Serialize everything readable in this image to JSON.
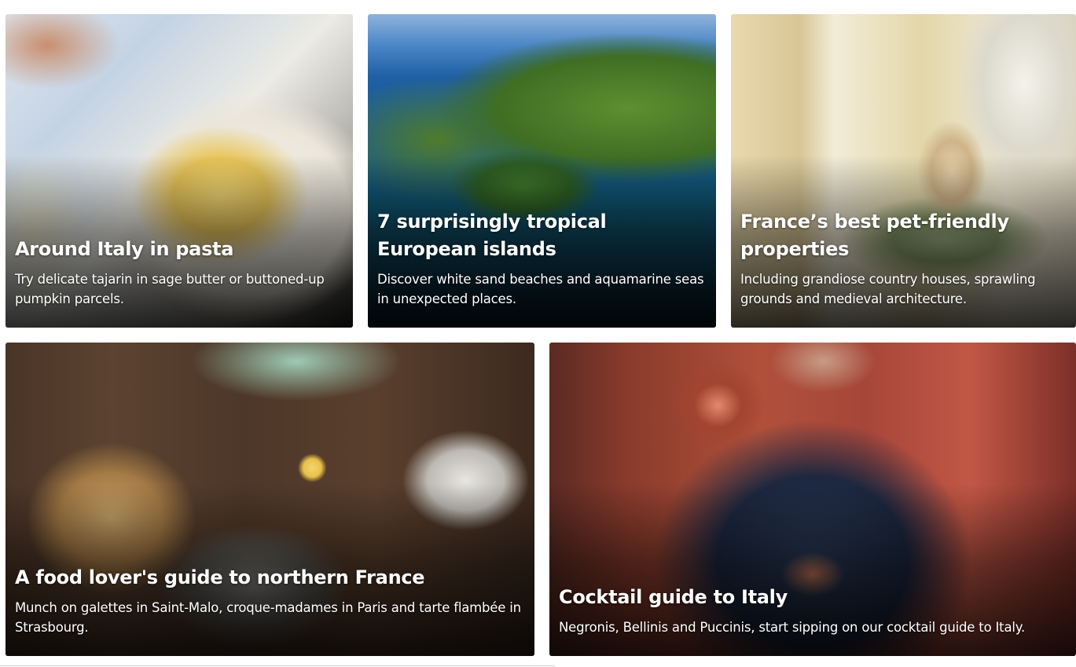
{
  "cards": [
    {
      "title": "Around Italy in pasta",
      "description": "Try delicate tajarin in sage butter or buttoned-up pumpkin parcels."
    },
    {
      "title": "7 surprisingly tropical European islands",
      "description": "Discover white sand beaches and aquamarine seas in unexpected places."
    },
    {
      "title": "France’s best pet-friendly properties",
      "description": "Including grandiose country houses, sprawling grounds and medieval architecture."
    },
    {
      "title": "A food lover's guide to northern France",
      "description": "Munch on galettes in Saint-Malo, croque-madames in Paris and tarte flambée in Strasbourg."
    },
    {
      "title": "Cocktail guide to Italy",
      "description": "Negronis, Bellinis and Puccinis, start sipping on our cocktail guide to Italy."
    }
  ]
}
